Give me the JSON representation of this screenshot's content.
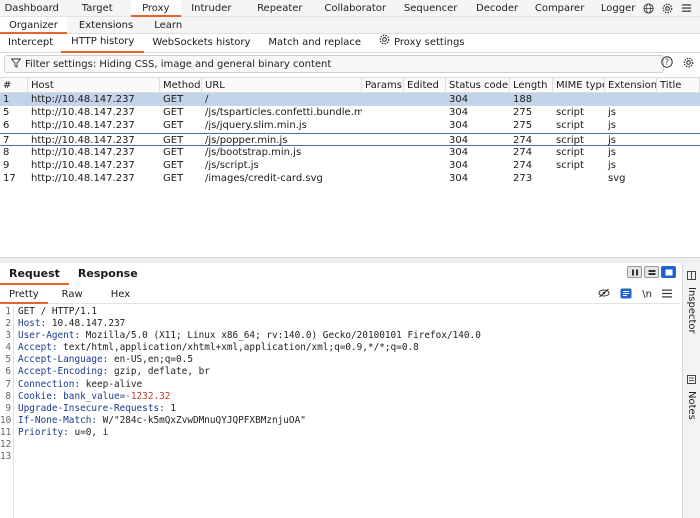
{
  "topnav": {
    "items": [
      "Dashboard",
      "Target",
      "Proxy",
      "Intruder",
      "Repeater",
      "Collaborator",
      "Sequencer",
      "Decoder",
      "Comparer",
      "Logger"
    ],
    "active": "Proxy"
  },
  "subnav": {
    "items": [
      "Organizer",
      "Extensions",
      "Learn"
    ]
  },
  "proxy_tabs": {
    "intercept": "Intercept",
    "http_history": "HTTP history",
    "websockets": "WebSockets history",
    "match_replace": "Match and replace",
    "settings": "Proxy settings"
  },
  "filter": {
    "text": "Filter settings: Hiding CSS, image and general binary content"
  },
  "table": {
    "columns": [
      "#",
      "Host",
      "Method",
      "URL",
      "Params",
      "Edited",
      "Status code",
      "Length",
      "MIME type",
      "Extension",
      "Title"
    ],
    "rows": [
      [
        "1",
        "http://10.48.147.237",
        "GET",
        "/",
        "",
        "",
        "304",
        "188",
        "",
        "",
        ""
      ],
      [
        "5",
        "http://10.48.147.237",
        "GET",
        "/js/tsparticles.confetti.bundle.min.js",
        "",
        "",
        "304",
        "275",
        "script",
        "js",
        ""
      ],
      [
        "6",
        "http://10.48.147.237",
        "GET",
        "/js/jquery.slim.min.js",
        "",
        "",
        "304",
        "275",
        "script",
        "js",
        ""
      ],
      [
        "7",
        "http://10.48.147.237",
        "GET",
        "/js/popper.min.js",
        "",
        "",
        "304",
        "274",
        "script",
        "js",
        ""
      ],
      [
        "8",
        "http://10.48.147.237",
        "GET",
        "/js/bootstrap.min.js",
        "",
        "",
        "304",
        "274",
        "script",
        "js",
        ""
      ],
      [
        "9",
        "http://10.48.147.237",
        "GET",
        "/js/script.js",
        "",
        "",
        "304",
        "274",
        "script",
        "js",
        ""
      ],
      [
        "17",
        "http://10.48.147.237",
        "GET",
        "/images/credit-card.svg",
        "",
        "",
        "304",
        "273",
        "",
        "svg",
        ""
      ]
    ]
  },
  "reqresp": {
    "request": "Request",
    "response": "Response"
  },
  "editor_tabs": {
    "pretty": "Pretty",
    "raw": "Raw",
    "hex": "Hex",
    "newline": "\\n"
  },
  "request_lines": {
    "l1": "GET / HTTP/1.1",
    "l2n": "Host:",
    "l2v": " 10.48.147.237",
    "l3n": "User-Agent:",
    "l3v": " Mozilla/5.0 (X11; Linux x86_64; rv:140.0) Gecko/20100101 Firefox/140.0",
    "l4n": "Accept:",
    "l4v": " text/html,application/xhtml+xml,application/xml;q=0.9,*/*;q=0.8",
    "l5n": "Accept-Language:",
    "l5v": " en-US,en;q=0.5",
    "l6n": "Accept-Encoding:",
    "l6v": " gzip, deflate, br",
    "l7n": "Connection:",
    "l7v": " keep-alive",
    "l8n": "Cookie:",
    "l8k": " bank_value=",
    "l8v": "-1232.32",
    "l9n": "Upgrade-Insecure-Requests:",
    "l9v": " 1",
    "l10n": "If-None-Match:",
    "l10v": " W/\"284c-k5mQxZvwDMnuQYJQPFXBMznjuOA\"",
    "l11n": "Priority:",
    "l11v": " u=0, i"
  },
  "line_numbers": [
    "1",
    "2",
    "3",
    "4",
    "5",
    "6",
    "7",
    "8",
    "9",
    "10",
    "11",
    "12",
    "13"
  ],
  "side_panel": {
    "inspector": "Inspector",
    "notes": "Notes"
  },
  "colors": {
    "accent": "#e8642c",
    "selected_row": "#c3d3ea",
    "toggle_active": "#1f63d4"
  }
}
